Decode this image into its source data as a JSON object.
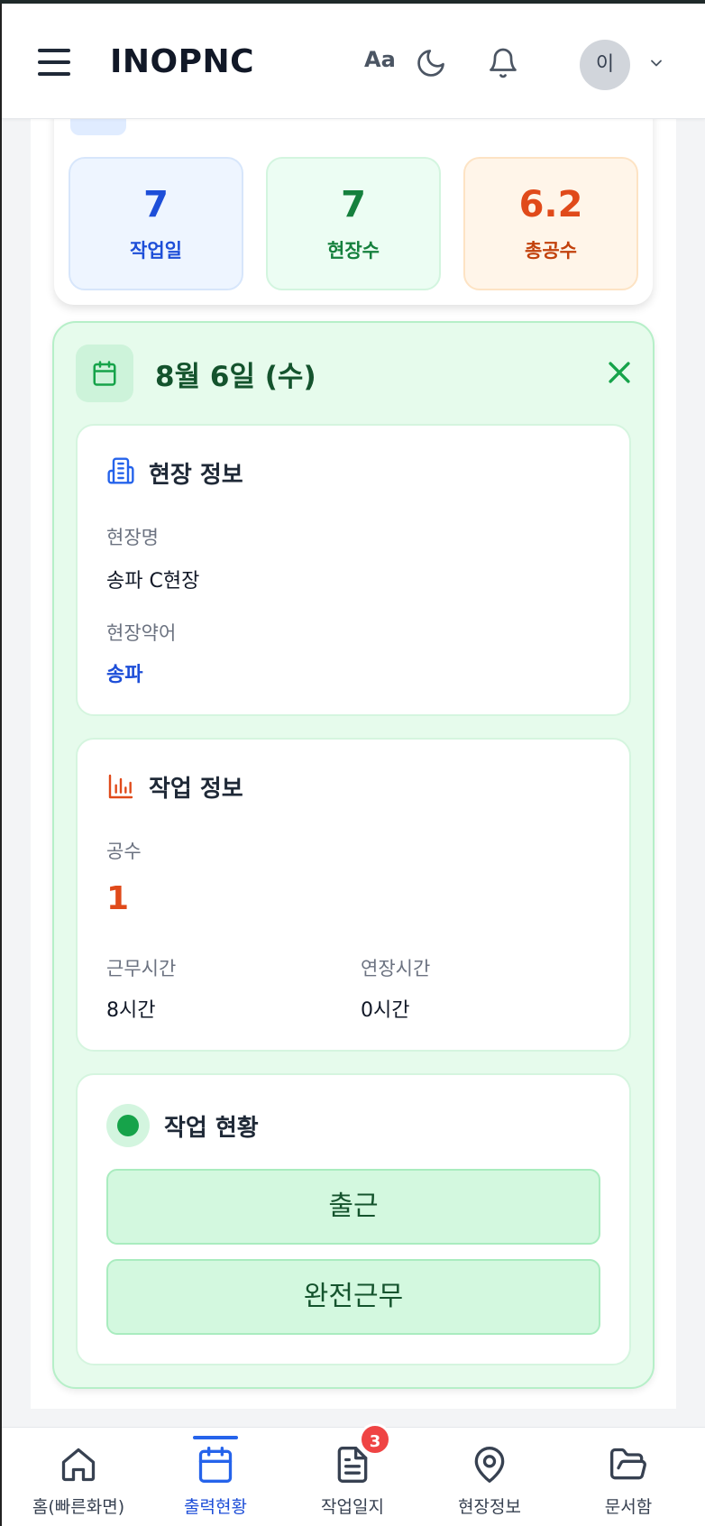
{
  "header": {
    "brand": "INOPNC",
    "font_size_label": "Aa",
    "avatar_initial": "이"
  },
  "summary": {
    "stats": [
      {
        "value": "7",
        "label": "작업일"
      },
      {
        "value": "7",
        "label": "현장수"
      },
      {
        "value": "6.2",
        "label": "총공수"
      }
    ]
  },
  "day_detail": {
    "title": "8월 6일 (수)",
    "site_info": {
      "title": "현장 정보",
      "name_label": "현장명",
      "name_value": "송파 C현장",
      "abbr_label": "현장약어",
      "abbr_value": "송파"
    },
    "work_info": {
      "title": "작업 정보",
      "manday_label": "공수",
      "manday_value": "1",
      "work_hours_label": "근무시간",
      "work_hours_value": "8시간",
      "overtime_label": "연장시간",
      "overtime_value": "0시간"
    },
    "work_status": {
      "title": "작업 현황",
      "buttons": [
        "출근",
        "완전근무"
      ]
    }
  },
  "bottom_nav": {
    "items": [
      {
        "label": "홈(빠른화면)",
        "icon": "home-icon"
      },
      {
        "label": "출력현황",
        "icon": "calendar-icon",
        "active": true
      },
      {
        "label": "작업일지",
        "icon": "document-icon",
        "badge": "3"
      },
      {
        "label": "현장정보",
        "icon": "map-pin-icon"
      },
      {
        "label": "문서함",
        "icon": "folder-icon"
      }
    ]
  },
  "colors": {
    "primary": "#2563eb",
    "green": "#16a34a",
    "orange": "#e04a1a"
  }
}
